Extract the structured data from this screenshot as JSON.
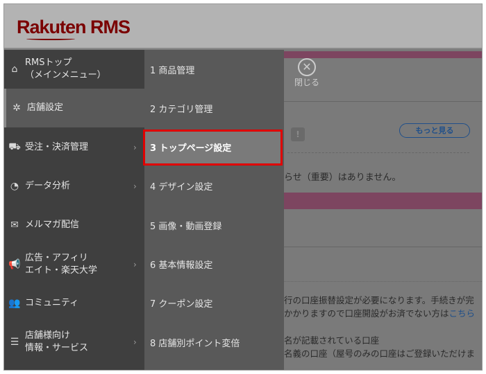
{
  "header": {
    "logo": "Rakuten RMS"
  },
  "menu": {
    "items": [
      {
        "label": "RMSトップ\n（メインメニュー）",
        "icon": "home-icon",
        "glyph": "⌂",
        "chevron": false
      },
      {
        "label": "店舗設定",
        "icon": "gear-icon",
        "glyph": "✲",
        "chevron": false,
        "active": true
      },
      {
        "label": "受注・決済管理",
        "icon": "cart-icon",
        "glyph": "⛟",
        "chevron": true
      },
      {
        "label": "データ分析",
        "icon": "pie-chart-icon",
        "glyph": "◔",
        "chevron": true
      },
      {
        "label": "メルマガ配信",
        "icon": "mail-icon",
        "glyph": "✉",
        "chevron": false
      },
      {
        "label": "広告・アフィリ\nエイト・楽天大学",
        "icon": "megaphone-icon",
        "glyph": "📢",
        "chevron": true
      },
      {
        "label": "コミュニティ",
        "icon": "people-icon",
        "glyph": "👥",
        "chevron": false
      },
      {
        "label": "店舗様向け\n情報・サービス",
        "icon": "list-icon",
        "glyph": "☰",
        "chevron": true
      }
    ],
    "chevron": "›"
  },
  "submenu": {
    "items": [
      "1 商品管理",
      "2 カテゴリ管理",
      "3 トップページ設定",
      "4 デザイン設定",
      "5 画像・動画登録",
      "6 基本情報設定",
      "7 クーポン設定",
      "8 店舗別ポイント変倍"
    ],
    "selected": 2
  },
  "content": {
    "close_label": "閉じる",
    "close_glyph": "✕",
    "more_label": "もっと見る",
    "bulb_glyph": "!",
    "notice": "らせ（重要）はありません。",
    "para1_line1": "行の口座振替設定が必要になります。手続きが完",
    "para1_line2a": "かかりますので口座開設がお済でない方は",
    "para1_link": "こちら",
    "para2_line1": "名が記載されている口座",
    "para2_line2": "名義の口座（屋号のみの口座はご登録いただけま"
  },
  "colors": {
    "accent_bar": "#7d4560",
    "selection_border": "#e00000",
    "link": "#1f4f8a",
    "logo": "#7a0000"
  }
}
